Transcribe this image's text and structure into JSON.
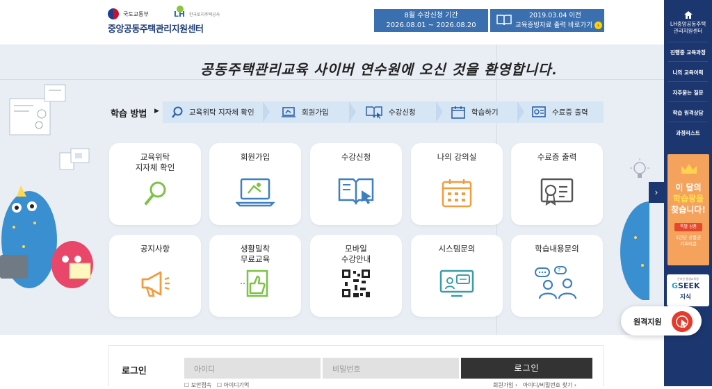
{
  "header": {
    "ministry": "국토교통부",
    "lh": "LH",
    "lh_sub": "한국토지주택공사",
    "title": "중앙공동주택관리지원센터",
    "notice1": {
      "line1": "8월 수강신청 기간",
      "line2": "2026.08.01 ~ 2026.08.20"
    },
    "notice2": {
      "line1": "2019.03.04 이전",
      "line2": "교육증빙자료 출력 바로가기"
    }
  },
  "welcome": "공동주택관리교육 사이버 연수원에 오신 것을 환영합니다.",
  "steps": {
    "label": "학습 방법",
    "items": [
      "교육위탁 지자체 확인",
      "회원가입",
      "수강신청",
      "학습하기",
      "수료증 출력"
    ]
  },
  "cards": {
    "row1": [
      {
        "l1": "교육위탁",
        "l2": "지자체 확인",
        "icon": "magnifier-icon"
      },
      {
        "l1": "회원가입",
        "l2": "",
        "icon": "laptop-icon"
      },
      {
        "l1": "수강신청",
        "l2": "",
        "icon": "book-icon"
      },
      {
        "l1": "나의 강의실",
        "l2": "",
        "icon": "calendar-icon"
      },
      {
        "l1": "수료증 출력",
        "l2": "",
        "icon": "certificate-icon"
      }
    ],
    "row2": [
      {
        "l1": "공지사항",
        "l2": "",
        "icon": "megaphone-icon"
      },
      {
        "l1": "생활밀착",
        "l2": "무료교육",
        "icon": "thumbs-up-icon"
      },
      {
        "l1": "모바일",
        "l2": "수강안내",
        "icon": "qr-code-icon"
      },
      {
        "l1": "시스템문의",
        "l2": "",
        "icon": "monitor-chat-icon"
      },
      {
        "l1": "학습내용문의",
        "l2": "",
        "icon": "people-chat-icon"
      }
    ]
  },
  "login": {
    "title": "로그인",
    "id_placeholder": "아이디",
    "pw_placeholder": "비밀번호",
    "button": "로그인",
    "opt1": "보안접속",
    "opt2": "아이디기억",
    "link1": "회원가입",
    "link2": "아이디/비밀번호 찾기"
  },
  "sidebar": {
    "home_l1": "LH중앙공동주택",
    "home_l2": "관리지원센터",
    "items": [
      "진행중 교육과정",
      "나의 교육이력",
      "자주묻는 질문",
      "학습 원격상담",
      "과정리스트"
    ]
  },
  "banner1": {
    "line1": "이 달의",
    "line2": "학습왕을",
    "line3": "찾습니다!",
    "tag": "특별 상품",
    "sub1": "1인당 상품권",
    "sub2": "기프티콘"
  },
  "banner2": {
    "small": "온라인 평생교육원",
    "logo_g": "G",
    "logo_rest": "SEEK",
    "sub": "지식"
  },
  "remote": {
    "label": "원격지원"
  },
  "colors": {
    "navy": "#1c3770",
    "notice_blue": "#3a6fb0",
    "icon_green": "#7cc243",
    "icon_blue": "#3d7fc1",
    "icon_orange": "#f39b3d"
  }
}
